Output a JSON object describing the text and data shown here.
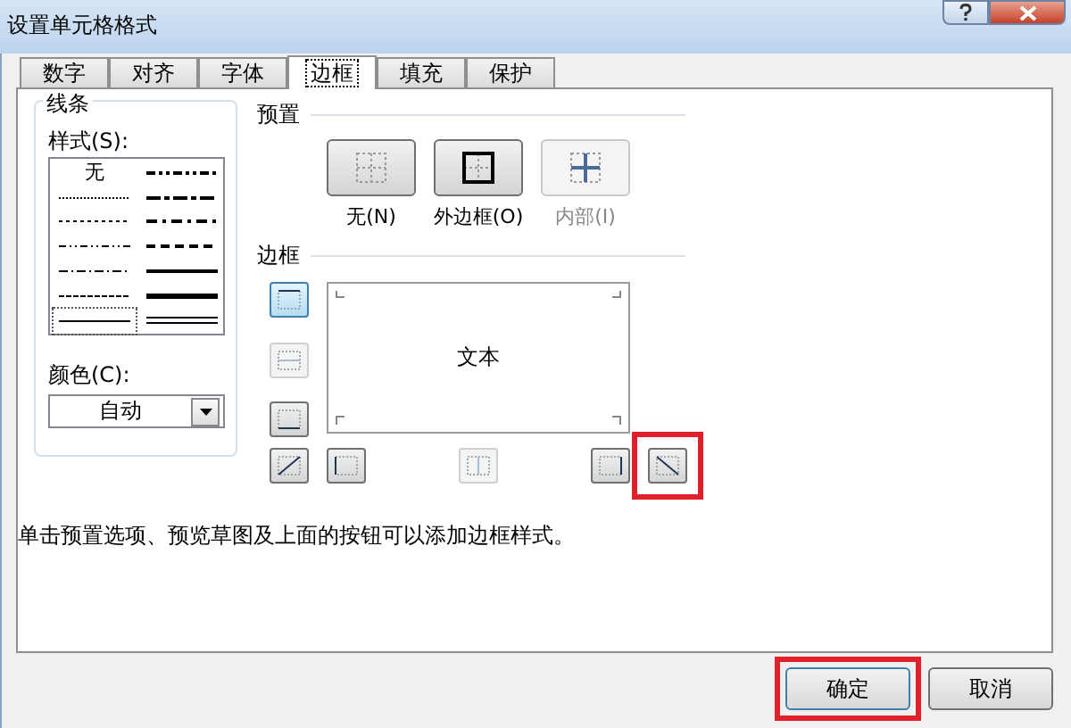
{
  "window": {
    "title": "设置单元格格式"
  },
  "tabs": [
    {
      "label": "数字",
      "selected": false
    },
    {
      "label": "对齐",
      "selected": false
    },
    {
      "label": "字体",
      "selected": false
    },
    {
      "label": "边框",
      "selected": true
    },
    {
      "label": "填充",
      "selected": false
    },
    {
      "label": "保护",
      "selected": false
    }
  ],
  "line": {
    "title": "线条",
    "style_label": "样式(S):",
    "styles": [
      {
        "kind": "none",
        "label": "无",
        "selected": false
      },
      {
        "kind": "medium-dashdotdot",
        "selected": false
      },
      {
        "kind": "hair",
        "selected": false
      },
      {
        "kind": "slanted-dashdot",
        "selected": false
      },
      {
        "kind": "dotted",
        "selected": false
      },
      {
        "kind": "medium-dashdot",
        "selected": false
      },
      {
        "kind": "dashdotdot",
        "selected": false
      },
      {
        "kind": "medium-dashed",
        "selected": false
      },
      {
        "kind": "dashdot",
        "selected": false
      },
      {
        "kind": "medium",
        "selected": false
      },
      {
        "kind": "dashed",
        "selected": false
      },
      {
        "kind": "thick",
        "selected": false
      },
      {
        "kind": "thin",
        "selected": true
      },
      {
        "kind": "double",
        "selected": false
      }
    ],
    "color_label": "颜色(C):",
    "color_value": "自动"
  },
  "presets": {
    "title": "预置",
    "items": [
      {
        "kind": "none",
        "label": "无(N)",
        "disabled": false
      },
      {
        "kind": "outline",
        "label": "外边框(O)",
        "disabled": false
      },
      {
        "kind": "inside",
        "label": "内部(I)",
        "disabled": true
      }
    ]
  },
  "border": {
    "title": "边框",
    "preview_text": "文本",
    "buttons": [
      {
        "kind": "top",
        "pressed": true,
        "disabled": false
      },
      {
        "kind": "middle-h",
        "pressed": false,
        "disabled": true
      },
      {
        "kind": "bottom",
        "pressed": false,
        "disabled": false
      },
      {
        "kind": "diag-up",
        "pressed": false,
        "disabled": false
      },
      {
        "kind": "left",
        "pressed": false,
        "disabled": false
      },
      {
        "kind": "middle-v",
        "pressed": false,
        "disabled": true
      },
      {
        "kind": "right",
        "pressed": false,
        "disabled": false
      },
      {
        "kind": "diag-down",
        "pressed": false,
        "disabled": false,
        "highlighted": true
      }
    ]
  },
  "hint": "单击预置选项、预览草图及上面的按钮可以添加边框样式。",
  "buttons": [
    {
      "label": "确定",
      "default": true,
      "highlighted": true
    },
    {
      "label": "取消",
      "default": false
    }
  ]
}
